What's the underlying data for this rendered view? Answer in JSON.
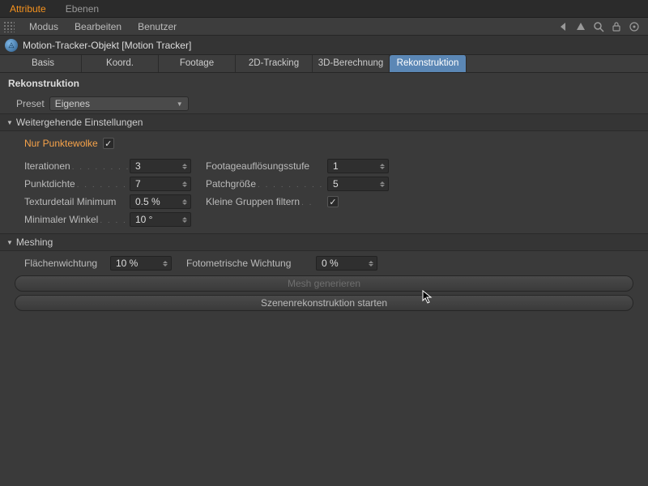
{
  "topTabs": {
    "active": "Attribute",
    "other": "Ebenen"
  },
  "menus": {
    "m1": "Modus",
    "m2": "Bearbeiten",
    "m3": "Benutzer"
  },
  "object": {
    "title": "Motion-Tracker-Objekt [Motion Tracker]"
  },
  "subtabs": {
    "t1": "Basis",
    "t2": "Koord.",
    "t3": "Footage",
    "t4": "2D-Tracking",
    "t5": "3D-Berechnung",
    "t6": "Rekonstruktion"
  },
  "section": {
    "title": "Rekonstruktion"
  },
  "preset": {
    "label": "Preset",
    "value": "Eigenes"
  },
  "group1": {
    "title": "Weitergehende Einstellungen"
  },
  "nurPunkte": {
    "label": "Nur Punktewolke",
    "checked": "✓"
  },
  "params": {
    "iter": {
      "label": "Iterationen",
      "value": "3"
    },
    "footres": {
      "label": "Footageauflösungsstufe",
      "value": "1"
    },
    "punktd": {
      "label": "Punktdichte",
      "value": "7"
    },
    "patch": {
      "label": "Patchgröße",
      "value": "5"
    },
    "texmin": {
      "label": "Texturdetail Minimum",
      "value": "0.5 %"
    },
    "kleine": {
      "label": "Kleine Gruppen filtern",
      "checked": "✓"
    },
    "minwinkel": {
      "label": "Minimaler Winkel",
      "value": "10 °"
    }
  },
  "group2": {
    "title": "Meshing"
  },
  "meshing": {
    "flaechen": {
      "label": "Flächenwichtung",
      "value": "10 %"
    },
    "foto": {
      "label": "Fotometrische Wichtung",
      "value": "0 %"
    }
  },
  "buttons": {
    "meshgen": "Mesh generieren",
    "reconstruct": "Szenenrekonstruktion starten"
  }
}
